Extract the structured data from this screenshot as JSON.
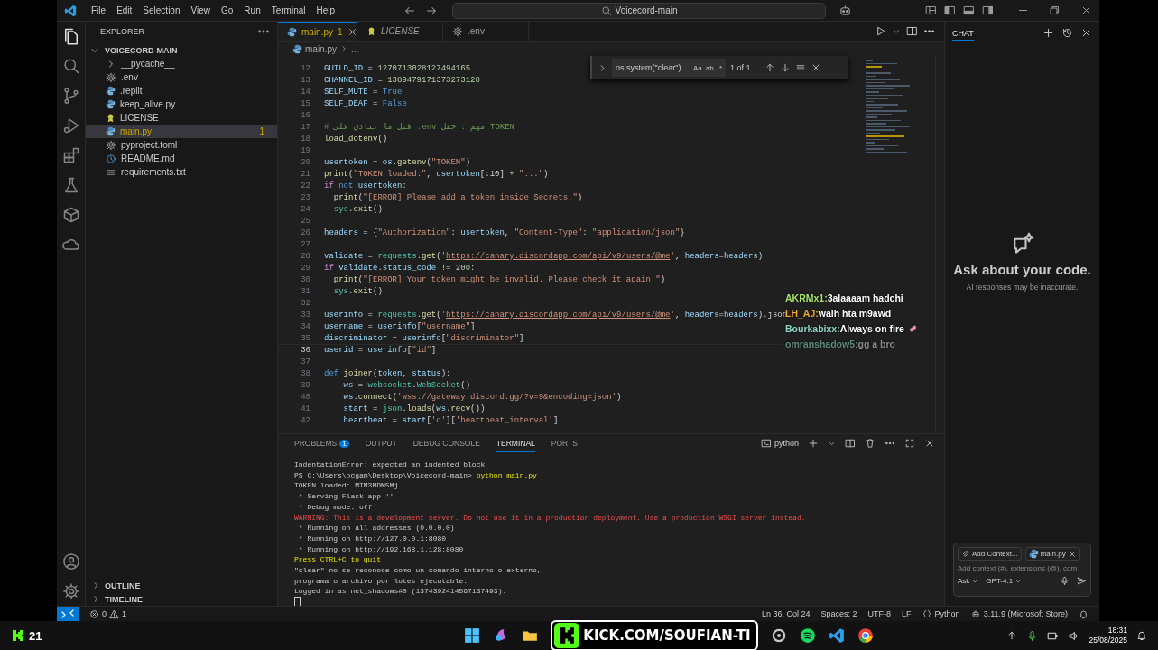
{
  "title_bar": {
    "menus": [
      "File",
      "Edit",
      "Selection",
      "View",
      "Go",
      "Run",
      "Terminal",
      "Help"
    ],
    "search": "Voicecord-main"
  },
  "explorer": {
    "title": "EXPLORER",
    "root": {
      "label": "VOICECORD-MAIN",
      "expanded": true,
      "children": [
        {
          "label": "__pycache__",
          "kind": "folder",
          "expanded": false,
          "selected": false
        },
        {
          "label": ".env",
          "kind": "config",
          "selected": false
        },
        {
          "label": ".replit",
          "kind": "python",
          "selected": false
        },
        {
          "label": "keep_alive.py",
          "kind": "python",
          "selected": false
        },
        {
          "label": "LICENSE",
          "kind": "license",
          "selected": false
        },
        {
          "label": "main.py",
          "kind": "python",
          "selected": true,
          "badge": "1"
        },
        {
          "label": "pyproject.toml",
          "kind": "config",
          "selected": false
        },
        {
          "label": "README.md",
          "kind": "info",
          "selected": false
        },
        {
          "label": "requirements.txt",
          "kind": "text",
          "selected": false
        }
      ]
    },
    "sections": [
      {
        "label": "OUTLINE",
        "expanded": false
      },
      {
        "label": "TIMELINE",
        "expanded": false
      }
    ]
  },
  "tabs": [
    {
      "label": "main.py",
      "kind": "python",
      "selected": true,
      "badge": "1",
      "italic": false
    },
    {
      "label": "LICENSE",
      "kind": "license",
      "selected": false,
      "italic": true
    },
    {
      "label": ".env",
      "kind": "config",
      "selected": false,
      "italic": false
    }
  ],
  "breadcrumb": [
    "main.py",
    "..."
  ],
  "find_widget": {
    "value": "os.system(\"clear\")",
    "options": [
      "Aa",
      "ab",
      ".*"
    ],
    "result": "1 of 1"
  },
  "code_lines": [
    {
      "number": "12",
      "current": false,
      "tokens": [
        {
          "kind": "var",
          "text": "GUILD_ID"
        },
        {
          "kind": "op",
          "text": " = "
        },
        {
          "kind": "num",
          "text": "1270713028127494165"
        }
      ]
    },
    {
      "number": "13",
      "current": false,
      "tokens": [
        {
          "kind": "var",
          "text": "CHANNEL_ID"
        },
        {
          "kind": "op",
          "text": " = "
        },
        {
          "kind": "num",
          "text": "1389479171373273128"
        }
      ]
    },
    {
      "number": "14",
      "current": false,
      "tokens": [
        {
          "kind": "var",
          "text": "SELF_MUTE"
        },
        {
          "kind": "op",
          "text": " = "
        },
        {
          "kind": "const",
          "text": "True"
        }
      ]
    },
    {
      "number": "15",
      "current": false,
      "tokens": [
        {
          "kind": "var",
          "text": "SELF_DEAF"
        },
        {
          "kind": "op",
          "text": " = "
        },
        {
          "kind": "const",
          "text": "False"
        }
      ]
    },
    {
      "number": "16",
      "current": false
    },
    {
      "number": "17",
      "current": false,
      "tokens": [
        {
          "kind": "comment",
          "text": "# قبل ما تنادي على .env مهم : حقل TOKEN"
        }
      ]
    },
    {
      "number": "18",
      "current": false,
      "tokens": [
        {
          "kind": "fn",
          "text": "load_dotenv"
        },
        {
          "kind": "op",
          "text": "()"
        }
      ]
    },
    {
      "number": "19",
      "current": false
    },
    {
      "number": "20",
      "current": false,
      "tokens": [
        {
          "kind": "var",
          "text": "usertoken"
        },
        {
          "kind": "op",
          "text": " = "
        },
        {
          "kind": "var",
          "text": "os"
        },
        {
          "kind": "op",
          "text": "."
        },
        {
          "kind": "fn",
          "text": "getenv"
        },
        {
          "kind": "op",
          "text": "("
        },
        {
          "kind": "str",
          "text": "\"TOKEN\""
        },
        {
          "kind": "op",
          "text": ")"
        }
      ]
    },
    {
      "number": "21",
      "current": false,
      "tokens": [
        {
          "kind": "fn",
          "text": "print"
        },
        {
          "kind": "op",
          "text": "("
        },
        {
          "kind": "str",
          "text": "\"TOKEN loaded:\""
        },
        {
          "kind": "op",
          "text": ", "
        },
        {
          "kind": "var",
          "text": "usertoken"
        },
        {
          "kind": "op",
          "text": "[:10] + "
        },
        {
          "kind": "str",
          "text": "\"...\""
        },
        {
          "kind": "op",
          "text": ")"
        }
      ]
    },
    {
      "number": "22",
      "current": false,
      "tokens": [
        {
          "kind": "kw",
          "text": "if "
        },
        {
          "kind": "const",
          "text": "not "
        },
        {
          "kind": "var",
          "text": "usertoken"
        },
        {
          "kind": "op",
          "text": ":"
        }
      ]
    },
    {
      "number": "23",
      "current": false,
      "tokens": [
        {
          "kind": "fn",
          "text": "  print"
        },
        {
          "kind": "op",
          "text": "("
        },
        {
          "kind": "str",
          "text": "\"[ERROR] Please add a token inside Secrets.\""
        },
        {
          "kind": "op",
          "text": ")"
        }
      ]
    },
    {
      "number": "24",
      "current": false,
      "tokens": [
        {
          "kind": "cls",
          "text": "  sys"
        },
        {
          "kind": "op",
          "text": "."
        },
        {
          "kind": "fn",
          "text": "exit"
        },
        {
          "kind": "op",
          "text": "()"
        }
      ]
    },
    {
      "number": "25",
      "current": false
    },
    {
      "number": "26",
      "current": false,
      "tokens": [
        {
          "kind": "var",
          "text": "headers"
        },
        {
          "kind": "op",
          "text": " = {"
        },
        {
          "kind": "str",
          "text": "\"Authorization\""
        },
        {
          "kind": "op",
          "text": ": "
        },
        {
          "kind": "var",
          "text": "usertoken"
        },
        {
          "kind": "op",
          "text": ", "
        },
        {
          "kind": "str",
          "text": "\"Content-Type\""
        },
        {
          "kind": "op",
          "text": ": "
        },
        {
          "kind": "str",
          "text": "\"application/json\""
        },
        {
          "kind": "op",
          "text": "}"
        }
      ]
    },
    {
      "number": "27",
      "current": false
    },
    {
      "number": "28",
      "current": false,
      "tokens": [
        {
          "kind": "var",
          "text": "validate"
        },
        {
          "kind": "op",
          "text": " = "
        },
        {
          "kind": "cls",
          "text": "requests"
        },
        {
          "kind": "op",
          "text": "."
        },
        {
          "kind": "fn",
          "text": "get"
        },
        {
          "kind": "op",
          "text": "("
        },
        {
          "kind": "str",
          "text": "'"
        },
        {
          "kind": "url",
          "text": "https://canary.discordapp.com/api/v9/users/@me"
        },
        {
          "kind": "str",
          "text": "'"
        },
        {
          "kind": "op",
          "text": ", "
        },
        {
          "kind": "var",
          "text": "headers"
        },
        {
          "kind": "op",
          "text": "="
        },
        {
          "kind": "var",
          "text": "headers"
        },
        {
          "kind": "op",
          "text": ")"
        }
      ]
    },
    {
      "number": "29",
      "current": false,
      "tokens": [
        {
          "kind": "kw",
          "text": "if "
        },
        {
          "kind": "var",
          "text": "validate"
        },
        {
          "kind": "op",
          "text": "."
        },
        {
          "kind": "var",
          "text": "status_code"
        },
        {
          "kind": "op",
          "text": " != "
        },
        {
          "kind": "num",
          "text": "200"
        },
        {
          "kind": "op",
          "text": ":"
        }
      ]
    },
    {
      "number": "30",
      "current": false,
      "tokens": [
        {
          "kind": "fn",
          "text": "  print"
        },
        {
          "kind": "op",
          "text": "("
        },
        {
          "kind": "str",
          "text": "\"[ERROR] Your token might be invalid. Please check it again.\""
        },
        {
          "kind": "op",
          "text": ")"
        }
      ]
    },
    {
      "number": "31",
      "current": false,
      "tokens": [
        {
          "kind": "cls",
          "text": "  sys"
        },
        {
          "kind": "op",
          "text": "."
        },
        {
          "kind": "fn",
          "text": "exit"
        },
        {
          "kind": "op",
          "text": "()"
        }
      ]
    },
    {
      "number": "32",
      "current": false
    },
    {
      "number": "33",
      "current": false,
      "tokens": [
        {
          "kind": "var",
          "text": "userinfo"
        },
        {
          "kind": "op",
          "text": " = "
        },
        {
          "kind": "cls",
          "text": "requests"
        },
        {
          "kind": "op",
          "text": "."
        },
        {
          "kind": "fn",
          "text": "get"
        },
        {
          "kind": "op",
          "text": "("
        },
        {
          "kind": "str",
          "text": "'"
        },
        {
          "kind": "url",
          "text": "https://canary.discordapp.com/api/v9/users/@me"
        },
        {
          "kind": "str",
          "text": "'"
        },
        {
          "kind": "op",
          "text": ", "
        },
        {
          "kind": "var",
          "text": "headers"
        },
        {
          "kind": "op",
          "text": "="
        },
        {
          "kind": "var",
          "text": "headers"
        },
        {
          "kind": "op",
          "text": ").json"
        }
      ]
    },
    {
      "number": "34",
      "current": false,
      "tokens": [
        {
          "kind": "var",
          "text": "username"
        },
        {
          "kind": "op",
          "text": " = "
        },
        {
          "kind": "var",
          "text": "userinfo"
        },
        {
          "kind": "op",
          "text": "["
        },
        {
          "kind": "str",
          "text": "\"username\""
        },
        {
          "kind": "op",
          "text": "]"
        }
      ]
    },
    {
      "number": "35",
      "current": false,
      "tokens": [
        {
          "kind": "var",
          "text": "discriminator"
        },
        {
          "kind": "op",
          "text": " = "
        },
        {
          "kind": "var",
          "text": "userinfo"
        },
        {
          "kind": "op",
          "text": "["
        },
        {
          "kind": "str",
          "text": "\"discriminator\""
        },
        {
          "kind": "op",
          "text": "]"
        }
      ]
    },
    {
      "number": "36",
      "current": true,
      "tokens": [
        {
          "kind": "var",
          "text": "userid"
        },
        {
          "kind": "op",
          "text": " = "
        },
        {
          "kind": "var",
          "text": "userinfo"
        },
        {
          "kind": "op",
          "text": "["
        },
        {
          "kind": "str",
          "text": "\"id\""
        },
        {
          "kind": "op",
          "text": "]"
        }
      ]
    },
    {
      "number": "37",
      "current": false
    },
    {
      "number": "38",
      "current": false,
      "tokens": [
        {
          "kind": "const",
          "text": "def "
        },
        {
          "kind": "fn",
          "text": "joiner"
        },
        {
          "kind": "op",
          "text": "("
        },
        {
          "kind": "var",
          "text": "token"
        },
        {
          "kind": "op",
          "text": ", "
        },
        {
          "kind": "var",
          "text": "status"
        },
        {
          "kind": "op",
          "text": "):"
        }
      ]
    },
    {
      "number": "39",
      "current": false,
      "tokens": [
        {
          "kind": "var",
          "text": "    ws"
        },
        {
          "kind": "op",
          "text": " = "
        },
        {
          "kind": "cls",
          "text": "websocket"
        },
        {
          "kind": "op",
          "text": "."
        },
        {
          "kind": "cls",
          "text": "WebSocket"
        },
        {
          "kind": "op",
          "text": "()"
        }
      ]
    },
    {
      "number": "40",
      "current": false,
      "tokens": [
        {
          "kind": "var",
          "text": "    ws"
        },
        {
          "kind": "op",
          "text": "."
        },
        {
          "kind": "fn",
          "text": "connect"
        },
        {
          "kind": "op",
          "text": "("
        },
        {
          "kind": "str",
          "text": "'wss://gateway.discord.gg/?v=9&encoding=json'"
        },
        {
          "kind": "op",
          "text": ")"
        }
      ]
    },
    {
      "number": "41",
      "current": false,
      "tokens": [
        {
          "kind": "var",
          "text": "    start"
        },
        {
          "kind": "op",
          "text": " = "
        },
        {
          "kind": "cls",
          "text": "json"
        },
        {
          "kind": "op",
          "text": "."
        },
        {
          "kind": "fn",
          "text": "loads"
        },
        {
          "kind": "op",
          "text": "("
        },
        {
          "kind": "var",
          "text": "ws"
        },
        {
          "kind": "op",
          "text": "."
        },
        {
          "kind": "fn",
          "text": "recv"
        },
        {
          "kind": "op",
          "text": "())"
        }
      ]
    },
    {
      "number": "42",
      "current": false,
      "tokens": [
        {
          "kind": "var",
          "text": "    heartbeat"
        },
        {
          "kind": "op",
          "text": " = "
        },
        {
          "kind": "var",
          "text": "start"
        },
        {
          "kind": "op",
          "text": "["
        },
        {
          "kind": "str",
          "text": "'d'"
        },
        {
          "kind": "op",
          "text": "]["
        },
        {
          "kind": "str",
          "text": "'heartbeat_interval'"
        },
        {
          "kind": "op",
          "text": "]"
        }
      ]
    }
  ],
  "stream_chat": [
    {
      "user": "AKRMx1:",
      "message": "3alaaaam hadchi",
      "color": "#a6e36e",
      "faded": false,
      "emote": false
    },
    {
      "user": "LH_AJ:",
      "message": "walh hta m9awd",
      "color": "#f0a830",
      "faded": false,
      "emote": false
    },
    {
      "user": "Bourkabixx:",
      "message": "Always on fire",
      "color": "#8fd6c6",
      "faded": false,
      "emote": true
    },
    {
      "user": "omranshadow5:",
      "message": "gg a bro",
      "color": "#5f8a80",
      "faded": true,
      "emote": false
    }
  ],
  "panel": {
    "tabs": [
      {
        "label": "PROBLEMS",
        "selected": false,
        "badge": "1"
      },
      {
        "label": "OUTPUT",
        "selected": false
      },
      {
        "label": "DEBUG CONSOLE",
        "selected": false
      },
      {
        "label": "TERMINAL",
        "selected": true
      },
      {
        "label": "PORTS",
        "selected": false
      }
    ],
    "terminal_name": "python",
    "lines": [
      {
        "kind": "plain",
        "text": "IndentationError: expected an indented block"
      },
      {
        "kind": "prompt",
        "text": "PS C:\\Users\\pcgam\\Desktop\\Voicecord-main> ",
        "command": "python main.py"
      },
      {
        "kind": "plain",
        "text": "TOKEN loaded: MTM3NDM5Mj..."
      },
      {
        "kind": "plain",
        "text": " * Serving Flask app ''"
      },
      {
        "kind": "plain",
        "text": " * Debug mode: off"
      },
      {
        "kind": "error",
        "text": "WARNING: This is a development server. Do not use it in a production deployment. Use a production WSGI server instead."
      },
      {
        "kind": "plain",
        "text": " * Running on all addresses (0.0.0.0)"
      },
      {
        "kind": "plain",
        "text": " * Running on http://127.0.0.1:8080"
      },
      {
        "kind": "plain",
        "text": " * Running on http://192.168.1.128:8080"
      },
      {
        "kind": "highlight",
        "text": "Press CTRL+C to quit"
      },
      {
        "kind": "plain",
        "text": "\"clear\" no se reconoce como un comando interno o externo,"
      },
      {
        "kind": "plain",
        "text": "programa o archivo por lotes ejecutable."
      },
      {
        "kind": "plain",
        "text": "Logged in as net_shadows#0 (1374392414567137493)."
      }
    ]
  },
  "chat": {
    "tab": "CHAT",
    "title": "Ask about your code.",
    "subtitle": "AI responses may be inaccurate.",
    "chips": [
      "Add Context...",
      "main.py"
    ],
    "placeholder": "Add context (#), extensions (@), com",
    "mode": "Ask",
    "model": "GPT-4.1"
  },
  "status_bar": {
    "errors": "0",
    "warnings": "1",
    "items": [
      "Ln 36, Col 24",
      "Spaces: 2",
      "UTF-8",
      "LF"
    ],
    "language": "Python",
    "interpreter": "3.11.9 (Microsoft Store)"
  },
  "taskbar": {
    "viewer_count": "21",
    "banner": "KICK.COM/SOUFIAN-TI",
    "time": "18:31",
    "date": "25/08/2025"
  }
}
